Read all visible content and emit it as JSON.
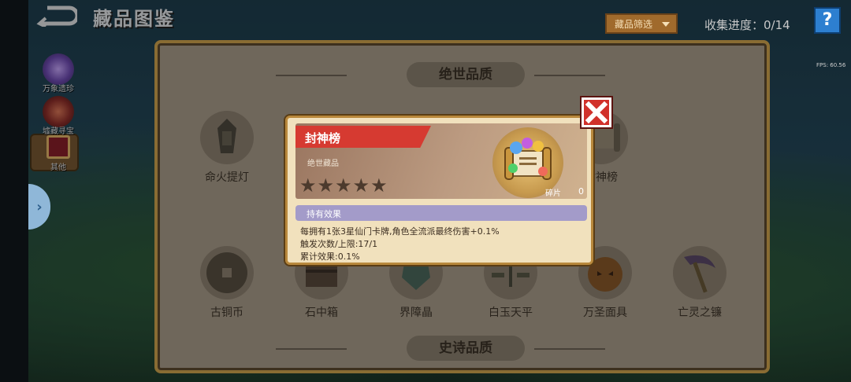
{
  "header": {
    "title": "藏品图鉴",
    "filter_label": "藏品筛选",
    "progress": "收集进度：0/14",
    "help_label": "?",
    "fps": "FPS: 60.56"
  },
  "sidebar": {
    "items": [
      {
        "label": "万象遗珍",
        "icon": "star-relic-icon"
      },
      {
        "label": "墟藏寻宝",
        "icon": "treasure-pot-icon"
      },
      {
        "label": "其他",
        "icon": "frame-icon",
        "active": true
      }
    ]
  },
  "sections": {
    "top": "绝世品质",
    "bottom": "史诗品质"
  },
  "items_row1": [
    {
      "name": "命火提灯",
      "icon": "lantern-icon"
    },
    {
      "name": "封神榜",
      "icon": "scroll-icon"
    }
  ],
  "items_row2": [
    {
      "name": "古铜币",
      "icon": "coin-icon"
    },
    {
      "name": "石中箱",
      "icon": "chest-icon"
    },
    {
      "name": "界障晶",
      "icon": "crystal-icon"
    },
    {
      "name": "白玉天平",
      "icon": "balance-icon"
    },
    {
      "name": "万圣面具",
      "icon": "pumpkin-mask-icon"
    },
    {
      "name": "亡灵之镰",
      "icon": "scythe-icon"
    }
  ],
  "modal": {
    "item_name": "封神榜",
    "rarity": "绝世藏品",
    "stars": 5,
    "fragment_label": "碎片",
    "fragment_count": "0",
    "effect_header": "持有效果",
    "effect_lines": [
      "每拥有1张3星仙门卡牌,角色全流派最终伤害+0.1%",
      "触发次数/上限:17/1",
      "累计效果:0.1%"
    ]
  },
  "colors": {
    "panel_border": "#d3a64f",
    "name_banner": "#d63a31",
    "close_button": "#d1312b",
    "effect_bar": "#a39bc9",
    "help_button": "#2d7fd0"
  }
}
